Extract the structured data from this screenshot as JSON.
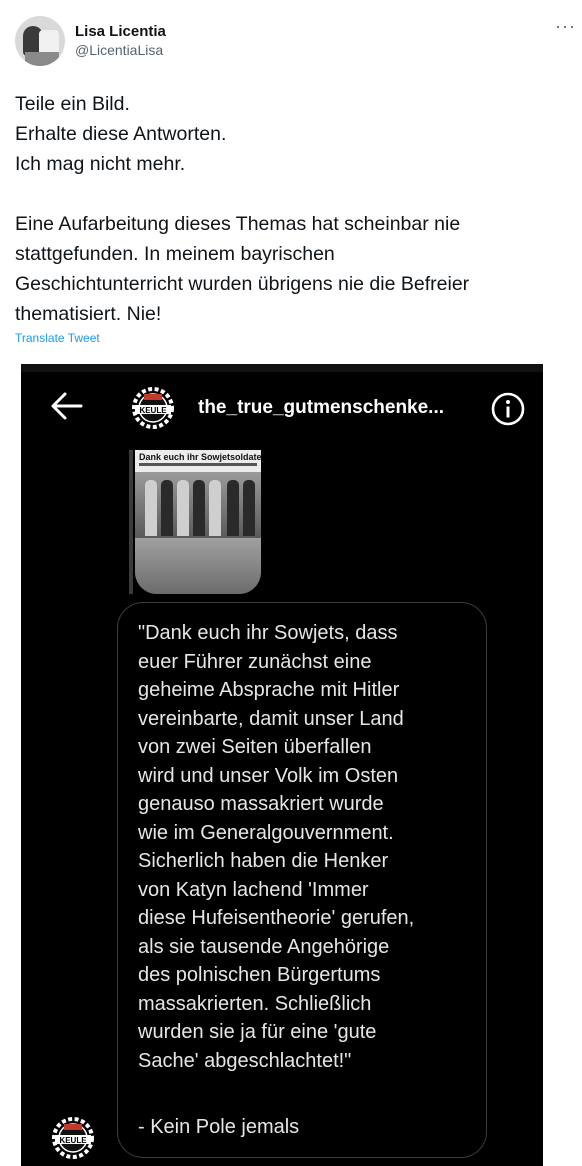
{
  "author": {
    "name": "Lisa Licentia",
    "handle": "@LicentiaLisa"
  },
  "menu_label": "···",
  "tweet": {
    "lines": [
      "Teile ein Bild.",
      "Erhalte diese Antworten.",
      "Ich mag nicht mehr.",
      "",
      "Eine Aufarbeitung dieses Themas hat scheinbar nie",
      "stattgefunden. In meinem bayrischen",
      "Geschichtunterricht wurden übrigens nie die Befreier",
      "thematisiert. Nie!"
    ],
    "translate_label": "Translate Tweet"
  },
  "screenshot": {
    "username": "the_true_gutmenschenke...",
    "logo_text": "KEULE",
    "thumbnail_title": "Dank euch ihr Sowjetsoldaten",
    "quote_lines": [
      "\"Dank euch ihr Sowjets, dass",
      "euer Führer zunächst eine",
      "geheime Absprache mit Hitler",
      "vereinbarte, damit unser Land",
      "von zwei Seiten überfallen",
      "wird und unser Volk im Osten",
      "genauso massakriert wurde",
      "wie im Generalgouvernment.",
      "Sicherlich haben die Henker",
      "von Katyn lachend 'Immer",
      "diese Hufeisentheorie' gerufen,",
      "als sie tausende Angehörige",
      "des polnischen Bürgertums",
      "massakrierten. Schließlich",
      "wurden sie ja für eine 'gute",
      "Sache' abgeschlachtet!\""
    ],
    "signature": "- Kein Pole jemals"
  },
  "colors": {
    "link": "#1d9bf0",
    "text": "#0f1419",
    "muted": "#536471",
    "dark_bg": "#000000"
  }
}
